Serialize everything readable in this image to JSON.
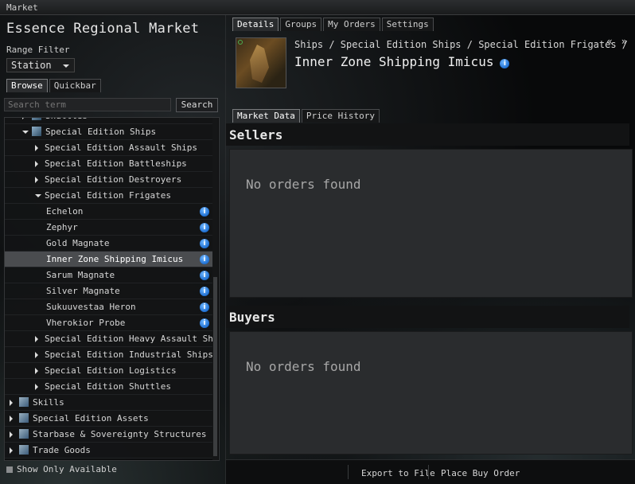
{
  "window": {
    "title": "Market"
  },
  "left": {
    "region_title": "Essence Regional Market",
    "range_filter_label": "Range Filter",
    "range_filter_value": "Station",
    "tabs": [
      "Browse",
      "Quickbar"
    ],
    "search_placeholder": "Search term",
    "search_button": "Search",
    "tree": [
      {
        "label": "Shuttles",
        "level": 1,
        "state": "collapsed"
      },
      {
        "label": "Special Edition Ships",
        "level": 1,
        "state": "expanded"
      },
      {
        "label": "Special Edition Assault Ships",
        "level": 2,
        "state": "collapsed"
      },
      {
        "label": "Special Edition Battleships",
        "level": 2,
        "state": "collapsed"
      },
      {
        "label": "Special Edition Destroyers",
        "level": 2,
        "state": "collapsed"
      },
      {
        "label": "Special Edition Frigates",
        "level": 2,
        "state": "expanded"
      },
      {
        "label": "Echelon",
        "level": 3,
        "state": "item"
      },
      {
        "label": "Zephyr",
        "level": 3,
        "state": "item"
      },
      {
        "label": "Gold Magnate",
        "level": 3,
        "state": "item"
      },
      {
        "label": "Inner Zone Shipping Imicus",
        "level": 3,
        "state": "item",
        "selected": true
      },
      {
        "label": "Sarum Magnate",
        "level": 3,
        "state": "item"
      },
      {
        "label": "Silver Magnate",
        "level": 3,
        "state": "item"
      },
      {
        "label": "Sukuuvestaa Heron",
        "level": 3,
        "state": "item"
      },
      {
        "label": "Vherokior Probe",
        "level": 3,
        "state": "item"
      },
      {
        "label": "Special Edition Heavy Assault Ships",
        "level": 2,
        "state": "collapsed"
      },
      {
        "label": "Special Edition Industrial Ships",
        "level": 2,
        "state": "collapsed"
      },
      {
        "label": "Special Edition Logistics",
        "level": 2,
        "state": "collapsed"
      },
      {
        "label": "Special Edition Shuttles",
        "level": 2,
        "state": "collapsed"
      },
      {
        "label": "Skills",
        "level": 0,
        "state": "collapsed"
      },
      {
        "label": "Special Edition Assets",
        "level": 0,
        "state": "collapsed"
      },
      {
        "label": "Starbase & Sovereignty Structures",
        "level": 0,
        "state": "collapsed"
      },
      {
        "label": "Trade Goods",
        "level": 0,
        "state": "collapsed"
      }
    ],
    "show_only_available": "Show Only Available"
  },
  "right": {
    "tabs": [
      "Details",
      "Groups",
      "My Orders",
      "Settings"
    ],
    "breadcrumb": "Ships / Special Edition Ships / Special Edition Frigates /",
    "item_name": "Inner Zone Shipping Imicus",
    "window_arrows": "« »",
    "subtabs": [
      "Market Data",
      "Price History"
    ],
    "sellers": {
      "title": "Sellers",
      "empty": "No orders found"
    },
    "buyers": {
      "title": "Buyers",
      "empty": "No orders found"
    },
    "export_button": "Export to File",
    "place_buy_button": "Place Buy Order"
  },
  "colors": {
    "info_icon": "#2b7fe0",
    "selected_row": "#4a4c4f",
    "section_bg": "#2a2c2e"
  }
}
